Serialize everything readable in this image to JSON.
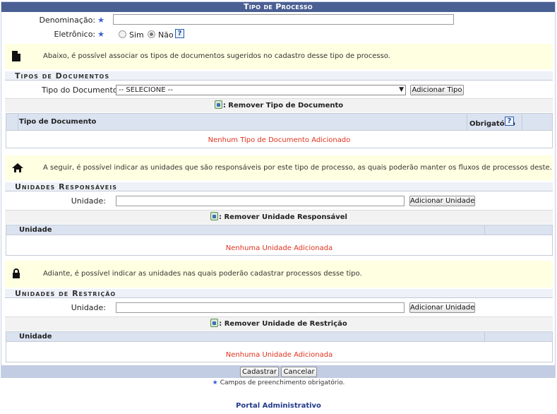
{
  "form": {
    "title": "Tipo de Processo",
    "denominacao_label": "Denominação:",
    "denominacao_value": "",
    "eletronico_label": "Eletrônico:",
    "sim_label": "Sim",
    "nao_label": "Não",
    "eletronico_selected": "Não",
    "required_marker": "★",
    "help_icon": "?"
  },
  "documentos": {
    "info_text": "Abaixo, é possível associar os tipos de documentos sugeridos no cadastro desse tipo de processo.",
    "section_title": "Tipos de Documentos",
    "tipo_label": "Tipo do Documento:",
    "select_value": "-- SELECIONE --",
    "add_button": "Adicionar Tipo",
    "remove_label": ": Remover Tipo de Documento",
    "col_tipo": "Tipo de Documento",
    "col_obrigatorio": "Obrigatório",
    "empty_text": "Nenhum Tipo de Documento Adicionado"
  },
  "responsaveis": {
    "info_text": "A seguir, é possível indicar as unidades que são responsáveis por este tipo de processo, as quais poderão manter os fluxos de processos deste.",
    "section_title": "Unidades Responsáveis",
    "unidade_label": "Unidade:",
    "unidade_value": "",
    "add_button": "Adicionar Unidade",
    "remove_label": ": Remover Unidade Responsável",
    "col_unidade": "Unidade",
    "empty_text": "Nenhuma Unidade Adicionada"
  },
  "restricao": {
    "info_text": "Adiante, é possível indicar as unidades nas quais poderão cadastrar processos desse tipo.",
    "section_title": "Unidades de Restrição",
    "unidade_label": "Unidade:",
    "unidade_value": "",
    "add_button": "Adicionar Unidade",
    "remove_label": ": Remover Unidade de Restrição",
    "col_unidade": "Unidade",
    "empty_text": "Nenhuma Unidade Adicionada"
  },
  "actions": {
    "cadastrar": "Cadastrar",
    "cancelar": "Cancelar"
  },
  "footer": {
    "required_note": "Campos de preenchimento obrigatório.",
    "portal": "Portal Administrativo"
  },
  "colors": {
    "title_bar": "#4a5f93",
    "info_bg": "#ffffe1",
    "empty_text": "#e0321e",
    "required_star": "#3a5fd6"
  }
}
